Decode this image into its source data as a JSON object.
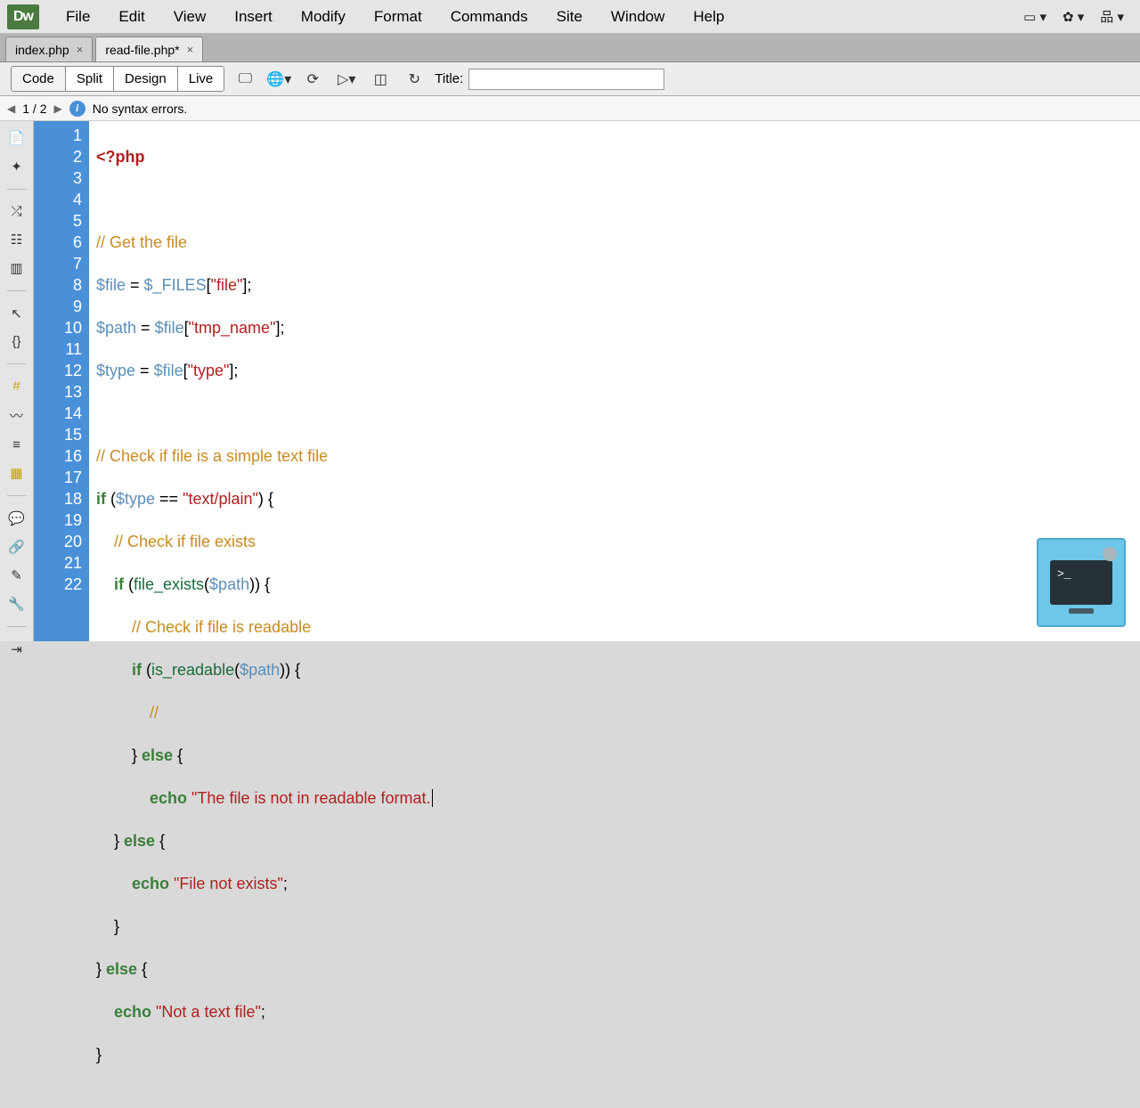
{
  "app_logo": "Dw",
  "menu": [
    "File",
    "Edit",
    "View",
    "Insert",
    "Modify",
    "Format",
    "Commands",
    "Site",
    "Window",
    "Help"
  ],
  "menubar_icons": [
    "layout-icon",
    "gear-icon",
    "sitemap-icon"
  ],
  "tabs": [
    {
      "label": "index.php",
      "active": false,
      "dirty": false
    },
    {
      "label": "read-file.php*",
      "active": true,
      "dirty": true
    }
  ],
  "views": [
    "Code",
    "Split",
    "Design",
    "Live"
  ],
  "active_view": "Code",
  "toolbar_icons": [
    "multiscreen-icon",
    "globe-icon",
    "validate-icon",
    "play-icon",
    "splitv-icon",
    "refresh-icon"
  ],
  "title_label": "Title:",
  "title_value": "",
  "status": {
    "pos": "1 / 2",
    "msg": "No syntax errors."
  },
  "line_numbers": [
    "1",
    "2",
    "3",
    "4",
    "5",
    "6",
    "7",
    "8",
    "9",
    "10",
    "11",
    "12",
    "13",
    "14",
    "15",
    "16",
    "17",
    "18",
    "19",
    "20",
    "21",
    "22"
  ],
  "code": {
    "l1_open": "<?php",
    "l3_c": "// Get the file",
    "l4_v1": "$file",
    "l4_eq": " = ",
    "l4_v2": "$_FILES",
    "l4_b": "[",
    "l4_s": "\"file\"",
    "l4_e": "];",
    "l5_v1": "$path",
    "l5_eq": " = ",
    "l5_v2": "$file",
    "l5_b": "[",
    "l5_s": "\"tmp_name\"",
    "l5_e": "];",
    "l6_v1": "$type",
    "l6_eq": " = ",
    "l6_v2": "$file",
    "l6_b": "[",
    "l6_s": "\"type\"",
    "l6_e": "];",
    "l8_c": "// Check if file is a simple text file",
    "l9_if": "if ",
    "l9_p1": "(",
    "l9_v": "$type",
    "l9_eq": " == ",
    "l9_s": "\"text/plain\"",
    "l9_p2": ") {",
    "l10_c": "    // Check if file exists",
    "l11_pre": "    ",
    "l11_if": "if ",
    "l11_p1": "(",
    "l11_fn": "file_exists",
    "l11_p2": "(",
    "l11_v": "$path",
    "l11_p3": ")) {",
    "l12_c": "        // Check if file is readable",
    "l13_pre": "        ",
    "l13_if": "if ",
    "l13_p1": "(",
    "l13_fn": "is_readable",
    "l13_p2": "(",
    "l13_v": "$path",
    "l13_p3": ")) {",
    "l14": "            //",
    "l15": "        } ",
    "l15_else": "else",
    " l15_b": " {",
    "l16_pre": "            ",
    "l16_echo": "echo ",
    "l16_s": "\"The file is not in readable format.",
    "l17": "    } ",
    "l17_else": "else",
    "l17_b": " {",
    "l18_pre": "        ",
    "l18_echo": "echo ",
    "l18_s": "\"File not exists\"",
    "l18_semi": ";",
    "l19": "    }",
    "l20": "} ",
    "l20_else": "else",
    "l20_b": " {",
    "l21_pre": "    ",
    "l21_echo": "echo ",
    "l21_s": "\"Not a text file\"",
    "l21_semi": ";",
    "l22": "}"
  },
  "left_tools": [
    "doc-icon",
    "sparkle-icon",
    "sep",
    "swap-icon",
    "grid-icon",
    "fill-icon",
    "sep",
    "pointer-icon",
    "braces-icon",
    "sep",
    "hash-star-icon",
    "slash-star-icon",
    "lines-icon",
    "highlight-icon",
    "sep",
    "chat-icon",
    "link-icon",
    "pencil-icon",
    "wrench-icon",
    "sep",
    "indent-icon"
  ]
}
